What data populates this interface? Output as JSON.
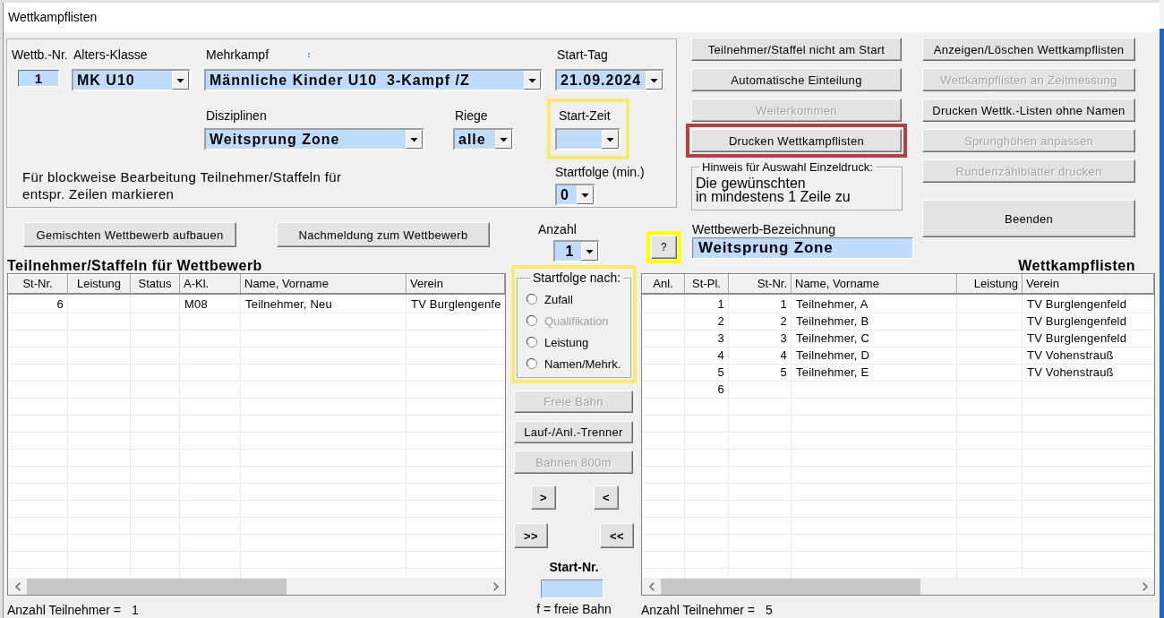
{
  "window": {
    "title": "Wettkampflisten"
  },
  "competition": {
    "number": {
      "label": "Wettb.-Nr.",
      "value": "1"
    },
    "age_class": {
      "label": "Alters-Klasse",
      "value": "MK U10"
    },
    "combined_event": {
      "label": "Mehrkampf",
      "value": "Männliche Kinder U10  3-Kampf /Z"
    },
    "start_day": {
      "label": "Start-Tag",
      "value": "21.09.2024"
    },
    "discipline": {
      "label": "Disziplinen",
      "value": "Weitsprung Zone"
    },
    "squad": {
      "label": "Riege",
      "value": "alle"
    },
    "start_time": {
      "label": "Start-Zeit",
      "highlighted": true
    },
    "block_hint": [
      "Für blockweise Bearbeitung Teilnehmer/Staffeln für",
      "entspr. Zeilen markieren"
    ],
    "start_interval": {
      "label": "Startfolge (min.)",
      "value": "0"
    }
  },
  "list_actions": [
    {
      "label": "Teilnehmer/Staffel nicht am Start",
      "disabled": false,
      "highlighted": false
    },
    {
      "label": "Automatische Einteilung",
      "disabled": false,
      "highlighted": false
    },
    {
      "label": "Weiterkommen",
      "disabled": true,
      "highlighted": false
    },
    {
      "label": "Drucken Wettkampflisten",
      "disabled": false,
      "highlighted": true
    }
  ],
  "single_print_hint": {
    "title": "Hinweis für Auswahl Einzeldruck:",
    "lines": [
      "Die gewünschten",
      "in mindestens 1 Zeile zu"
    ]
  },
  "competition_name": {
    "label": "Wettbewerb-Bezeichnung",
    "value": "Weitsprung Zone"
  },
  "list_management": [
    {
      "label": "Anzeigen/Löschen Wettkampflisten",
      "disabled": false
    },
    {
      "label": "Wettkampflisten an Zeitmessung",
      "disabled": true
    },
    {
      "label": "Drucken Wettk.-Listen ohne Namen",
      "disabled": false
    },
    {
      "label": "Sprunghöhen anpassen",
      "disabled": true
    },
    {
      "label": "Rundenzählblätter drucken",
      "disabled": true
    }
  ],
  "exit_button": {
    "label": "Beenden"
  },
  "entry_buttons": [
    {
      "label": "Gemischten Wettbewerb aufbauen"
    },
    {
      "label": "Nachmeldung zum Wettbewerb"
    }
  ],
  "count": {
    "label": "Anzahl",
    "value": "1"
  },
  "help_button": {
    "label": "?",
    "highlighted": true
  },
  "participants": {
    "title": "Teilnehmer/Staffeln für Wettbewerb",
    "columns": [
      "St-Nr.",
      "Leistung",
      "Status",
      "A-Kl.",
      "Name, Vorname",
      "Verein"
    ],
    "rows": [
      {
        "st_nr": "6",
        "a_kl": "M08",
        "name": "Teilnehmer, Neu",
        "club": "TV Burglengenfe"
      }
    ],
    "footer": {
      "label": "Anzahl Teilnehmer =",
      "value": "1"
    }
  },
  "start_order": {
    "title": "Startfolge nach:",
    "highlighted": true,
    "options": [
      {
        "label": "Zufall",
        "selected": false,
        "disabled": false
      },
      {
        "label": "Qualifikation",
        "selected": false,
        "disabled": true
      },
      {
        "label": "Leistung",
        "selected": false,
        "disabled": false
      },
      {
        "label": "Namen/Mehrk.",
        "selected": false,
        "disabled": false
      }
    ]
  },
  "lane_buttons": [
    {
      "label": "Freie Bahn",
      "disabled": true
    },
    {
      "label": "Lauf-/Anl.-Trenner",
      "disabled": false
    },
    {
      "label": "Bahnen 800m",
      "disabled": true
    }
  ],
  "move_buttons": [
    {
      "label": ">"
    },
    {
      "label": "<"
    },
    {
      "label": ">>"
    },
    {
      "label": "<<"
    }
  ],
  "start_number": {
    "label": "Start-Nr.",
    "note": "f = freie Bahn"
  },
  "competition_lists": {
    "title": "Wettkampflisten",
    "columns": [
      "Anl.",
      "St-Pl.",
      "St-Nr.",
      "Name, Vorname",
      "Leistung",
      "Verein"
    ],
    "rows": [
      {
        "place": "1",
        "st_nr": "1",
        "name": "Teilnehmer, A",
        "club": "TV Burglengenfeld"
      },
      {
        "place": "2",
        "st_nr": "2",
        "name": "Teilnehmer, B",
        "club": "TV Burglengenfeld"
      },
      {
        "place": "3",
        "st_nr": "3",
        "name": "Teilnehmer, C",
        "club": "TV Burglengenfeld"
      },
      {
        "place": "4",
        "st_nr": "4",
        "name": "Teilnehmer, D",
        "club": "TV Vohenstrauß"
      },
      {
        "place": "5",
        "st_nr": "5",
        "name": "Teilnehmer, E",
        "club": "TV Vohenstrauß"
      },
      {
        "place": "6"
      }
    ],
    "footer": {
      "label": "Anzahl Teilnehmer =",
      "value": "5"
    }
  }
}
